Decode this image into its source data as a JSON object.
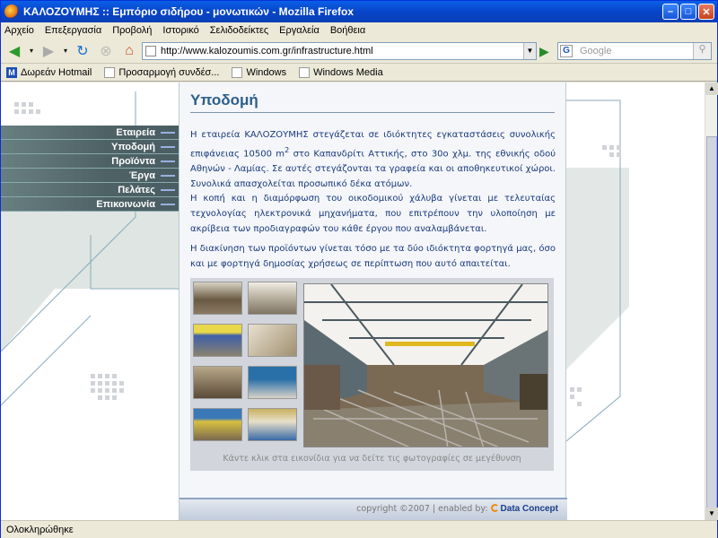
{
  "window": {
    "title": "ΚΑΛΟΖΟΥΜΗΣ :: Εμπόριο σιδήρου - μονωτικών - Mozilla Firefox"
  },
  "menu": {
    "items": [
      "Αρχείο",
      "Επεξεργασία",
      "Προβολή",
      "Ιστορικό",
      "Σελιδοδείκτες",
      "Εργαλεία",
      "Βοήθεια"
    ]
  },
  "address": {
    "url": "http://www.kalozoumis.com.gr/infrastructure.html"
  },
  "search": {
    "placeholder": "Google"
  },
  "bookmarks": {
    "items": [
      "Δωρεάν Hotmail",
      "Προσαρμογή συνδέσ...",
      "Windows",
      "Windows Media"
    ]
  },
  "status": {
    "text": "Ολοκληρώθηκε"
  },
  "sidebar": {
    "items": [
      "Εταιρεία",
      "Υποδομή",
      "Προϊόντα",
      "Έργα",
      "Πελάτες",
      "Επικοινωνία"
    ]
  },
  "page": {
    "title": "Υποδομή",
    "para1_a": "Η εταιρεία ΚΑΛΟΖΟΥΜΗΣ στεγάζεται σε ιδιόκτητες εγκαταστάσεις συνολικής επιφάνειας 10500 m",
    "para1_sup": "2",
    "para1_b": " στο Καπανδρίτι Αττικής, στο 30ο χλμ. της εθνικής οδού Αθηνών - Λαμίας. Σε αυτές στεγάζονται τα γραφεία και οι αποθηκευτικοί χώροι. Συνολικά απασχολείται προσωπικό δέκα ατόμων.",
    "para2": "Η κοπή και η διαμόρφωση του οικοδομικού χάλυβα γίνεται με τελευταίας τεχνολογίας ηλεκτρονικά μηχανήματα, που επιτρέπουν την υλοποίηση με ακρίβεια των προδιαγραφών του κάθε έργου που αναλαμβάνεται.",
    "para3": "Η διακίνηση των προϊόντων γίνεται τόσο με τα δύο ιδιόκτητα φορτηγά μας, όσο και με φορτηγά δημοσίας χρήσεως σε περίπτωση που αυτό απαιτείται.",
    "caption": "Κάντε κλικ στα εικονίδια για να δείτε τις φωτογραφίες σε μεγέθυνση",
    "footer": "copyright ©2007 | enabled by: ",
    "footer_brand": "Data Concept"
  },
  "colors": {
    "accent": "#2c5f8c",
    "nav": "#4e6266",
    "text": "#1a3a7a"
  }
}
